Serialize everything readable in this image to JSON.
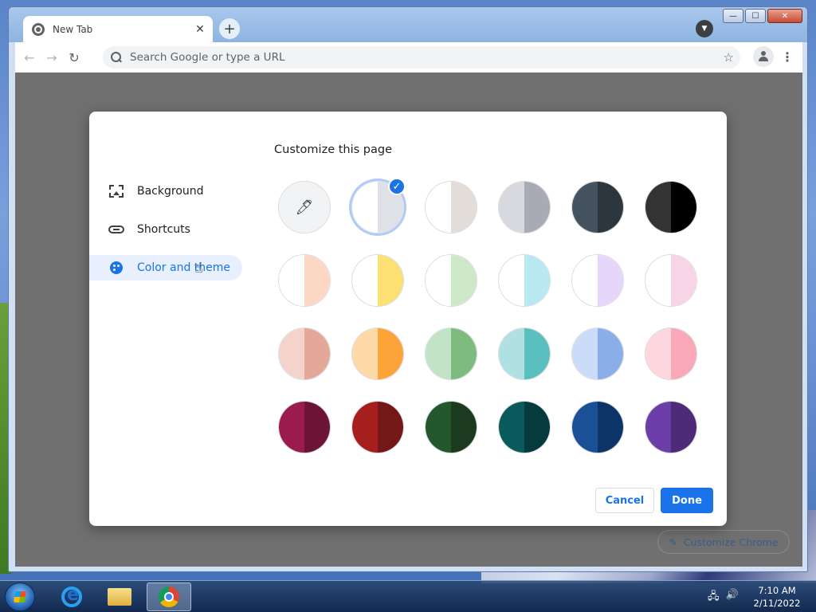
{
  "browser": {
    "tab_title": "New Tab",
    "tab_close": "✕",
    "new_tab": "+",
    "window_controls": {
      "minimize": "—",
      "maximize": "☐",
      "close": "✕"
    },
    "omnibox_placeholder": "Search Google or type a URL",
    "customize_chrome_label": "Customize Chrome"
  },
  "dialog": {
    "title": "Customize this page",
    "nav": [
      {
        "label": "Background",
        "icon": "image-icon"
      },
      {
        "label": "Shortcuts",
        "icon": "link-icon"
      },
      {
        "label": "Color and theme",
        "icon": "palette-icon",
        "active": true
      }
    ],
    "cancel_label": "Cancel",
    "done_label": "Done",
    "swatches": [
      [
        [
          "#f1f3f4",
          "#f1f3f4",
          "custom"
        ],
        [
          "#ffffff",
          "#dee1e6",
          "selected"
        ],
        [
          "#ffffff",
          "#e3ddd9",
          ""
        ],
        [
          "#d7d9df",
          "#a8abb4",
          ""
        ],
        [
          "#44535f",
          "#2c363f",
          ""
        ],
        [
          "#333333",
          "#000000",
          ""
        ]
      ],
      [
        [
          "#ffffff",
          "#fcd8c4",
          ""
        ],
        [
          "#ffffff",
          "#fde073",
          ""
        ],
        [
          "#ffffff",
          "#cde8c6",
          ""
        ],
        [
          "#ffffff",
          "#b8e8f0",
          ""
        ],
        [
          "#ffffff",
          "#e7d6fb",
          ""
        ],
        [
          "#ffffff",
          "#f8d5e6",
          ""
        ]
      ],
      [
        [
          "#f4d4ca",
          "#e3a898",
          ""
        ],
        [
          "#fed9a8",
          "#fca33a",
          ""
        ],
        [
          "#c3e3c7",
          "#7dbb7e",
          ""
        ],
        [
          "#b0e0e2",
          "#5bbfbf",
          ""
        ],
        [
          "#cadcf8",
          "#8aaee8",
          ""
        ],
        [
          "#fdd7dd",
          "#f9a8b8",
          ""
        ]
      ],
      [
        [
          "#9a1b4e",
          "#6c1336",
          ""
        ],
        [
          "#a61e1e",
          "#731717",
          ""
        ],
        [
          "#23572c",
          "#1b3a1f",
          ""
        ],
        [
          "#085a5c",
          "#053b3d",
          ""
        ],
        [
          "#1a5096",
          "#0d3466",
          ""
        ],
        [
          "#6b3ea8",
          "#4d2b78",
          ""
        ]
      ]
    ]
  },
  "taskbar": {
    "time": "7:10 AM",
    "date": "2/11/2022"
  }
}
